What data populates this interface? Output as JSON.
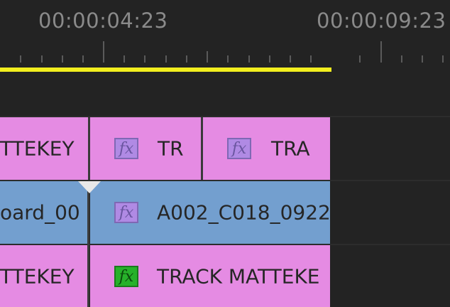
{
  "ruler": {
    "timecodes": [
      "00:00:04:23",
      "00:00:09:23"
    ]
  },
  "tracks": {
    "v3": {
      "clips": [
        {
          "label": "TTEKEY",
          "has_fx": false
        },
        {
          "label": "TR",
          "has_fx": true,
          "fx_label": "fx"
        },
        {
          "label": "TRA",
          "has_fx": true,
          "fx_label": "fx"
        }
      ]
    },
    "v2": {
      "clips": [
        {
          "label": "oard_00",
          "has_fx": false
        },
        {
          "label": "A002_C018_0922",
          "has_fx": true,
          "fx_label": "fx"
        }
      ]
    },
    "v1": {
      "clips": [
        {
          "label": "TTEKEY",
          "has_fx": false
        },
        {
          "label": "TRACK MATTEKE",
          "has_fx": true,
          "fx_label": "fx"
        }
      ]
    }
  },
  "colors": {
    "background": "#232323",
    "work_area_bar": "#f2ee1e",
    "matte_clip": "#e58be3",
    "video_clip": "#739fcf",
    "fx_badge_default": "#b08ae4",
    "fx_badge_active": "#27b12a"
  },
  "icons": {
    "fx_badge": "fx-icon",
    "playhead": "playhead-marker-icon"
  }
}
